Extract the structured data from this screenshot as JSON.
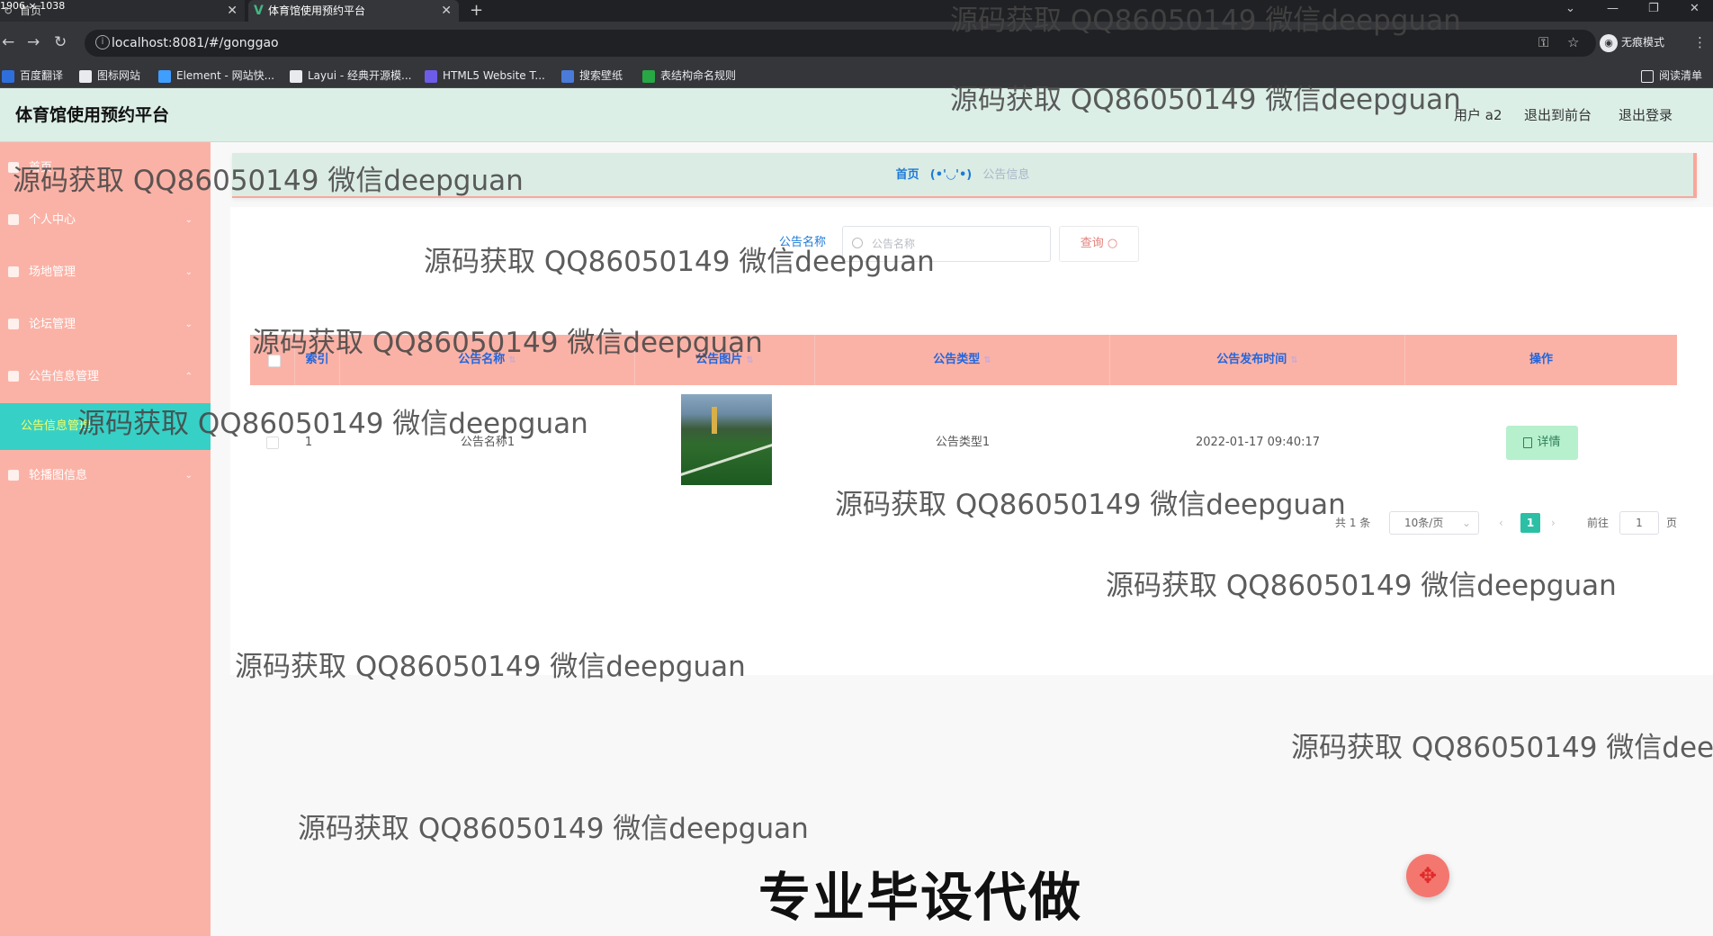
{
  "browser": {
    "dimension_label": "1906 × 1038",
    "tabs": [
      {
        "title": "首页",
        "active": false
      },
      {
        "title": "体育馆使用预约平台",
        "active": true
      }
    ],
    "url": "localhost:8081/#/gonggao",
    "profile_label": "无痕模式",
    "reading_list": "阅读清单",
    "bookmarks": [
      {
        "label": "百度翻译",
        "icon": "translate-icon",
        "color": "#2f6fdb"
      },
      {
        "label": "图标网站",
        "icon": "flag-icon",
        "color": "#e8eaed"
      },
      {
        "label": "Element - 网站快...",
        "icon": "element-icon",
        "color": "#409eff"
      },
      {
        "label": "Layui - 经典开源模...",
        "icon": "layui-icon",
        "color": "#e8eaed"
      },
      {
        "label": "HTML5 Website T...",
        "icon": "html5-icon",
        "color": "#6c5ce7"
      },
      {
        "label": "搜索壁纸",
        "icon": "wallpaper-icon",
        "color": "#4a7bd9"
      },
      {
        "label": "表结构命名规则",
        "icon": "sheet-icon",
        "color": "#27a844"
      }
    ]
  },
  "header": {
    "title": "体育馆使用预约平台",
    "user_label": "用户 a2",
    "front_link": "退出到前台",
    "logout_link": "退出登录"
  },
  "sidebar": {
    "items": [
      {
        "label": "首页",
        "icon": "home-icon",
        "arrow": ""
      },
      {
        "label": "个人中心",
        "icon": "user-icon",
        "arrow": "⌄"
      },
      {
        "label": "场地管理",
        "icon": "user-icon",
        "arrow": "⌄"
      },
      {
        "label": "论坛管理",
        "icon": "forum-icon",
        "arrow": "⌄"
      },
      {
        "label": "公告信息管理",
        "icon": "notice-icon",
        "arrow": "⌃"
      },
      {
        "label": "公告信息管理",
        "icon": "",
        "arrow": "",
        "active": true
      },
      {
        "label": "轮播图信息",
        "icon": "image-icon",
        "arrow": "⌄"
      }
    ]
  },
  "breadcrumb": {
    "home": "首页",
    "face": "(•'◡'•)",
    "current": "公告信息"
  },
  "search": {
    "label": "公告名称",
    "placeholder": "公告名称",
    "button": "查询"
  },
  "table": {
    "columns": [
      "索引",
      "公告名称",
      "公告图片",
      "公告类型",
      "公告发布时间",
      "操作"
    ],
    "rows": [
      {
        "index": "1",
        "name": "公告名称1",
        "image": "football-field-photo",
        "type": "公告类型1",
        "time": "2022-01-17 09:40:17",
        "action": "详情"
      }
    ]
  },
  "pagination": {
    "total": "共 1 条",
    "page_size": "10条/页",
    "current_page": "1",
    "goto_label": "前往",
    "goto_value": "1",
    "page_suffix": "页"
  },
  "watermark": {
    "text": "源码获取 QQ86050149 微信deepguan",
    "banner": "专业毕设代做"
  },
  "colors": {
    "sidebar": "#fbb2a6",
    "header": "#dcefe7",
    "accent_teal": "#37d0c6",
    "link_blue": "#1e7ad6"
  }
}
